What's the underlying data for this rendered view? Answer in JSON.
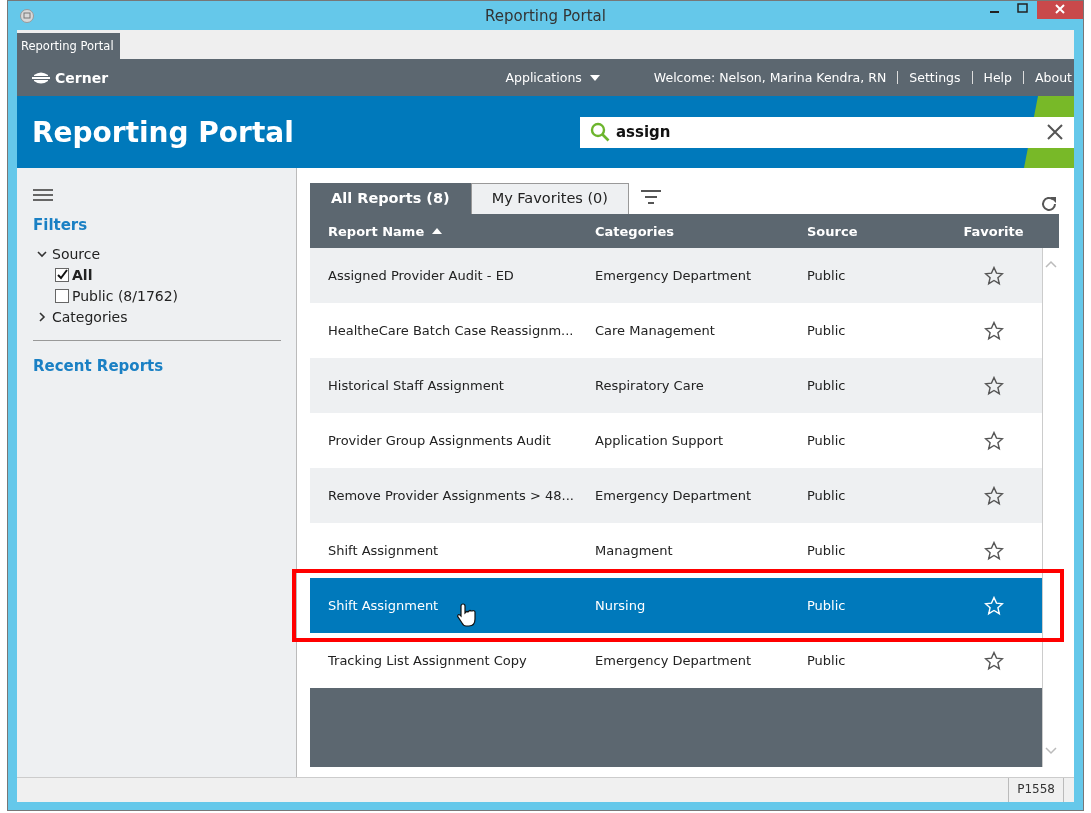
{
  "window": {
    "title": "Reporting Portal"
  },
  "app_tab": {
    "label": "Reporting Portal"
  },
  "nav": {
    "brand": "Cerner",
    "applications": "Applications",
    "welcome": "Welcome: Nelson, Marina Kendra, RN",
    "links": [
      "Settings",
      "Help",
      "About"
    ]
  },
  "banner": {
    "title": "Reporting Portal",
    "search": {
      "value": "assign"
    }
  },
  "sidebar": {
    "filters_title": "Filters",
    "groups": [
      {
        "label": "Source",
        "expanded": true,
        "children": [
          {
            "label": "All",
            "checked": true
          },
          {
            "label": "Public (8/1762)",
            "checked": false
          }
        ]
      },
      {
        "label": "Categories",
        "expanded": false
      }
    ],
    "recent_title": "Recent Reports"
  },
  "report_tabs": [
    {
      "label": "All Reports (8)",
      "selected": true
    },
    {
      "label": "My Favorites (0)",
      "selected": false
    }
  ],
  "table": {
    "columns": [
      "Report Name",
      "Categories",
      "Source",
      "Favorite"
    ],
    "rows": [
      {
        "name": "Assigned Provider Audit - ED",
        "category": "Emergency Department",
        "source": "Public",
        "selected": false,
        "highlighted": false
      },
      {
        "name": "HealtheCare Batch Case Reassignm...",
        "category": "Care Management",
        "source": "Public",
        "selected": false,
        "highlighted": false
      },
      {
        "name": "Historical Staff Assignment",
        "category": "Respiratory Care",
        "source": "Public",
        "selected": false,
        "highlighted": false
      },
      {
        "name": "Provider Group Assignments Audit",
        "category": "Application Support",
        "source": "Public",
        "selected": false,
        "highlighted": false
      },
      {
        "name": "Remove Provider Assignments > 48...",
        "category": "Emergency Department",
        "source": "Public",
        "selected": false,
        "highlighted": false
      },
      {
        "name": "Shift Assignment",
        "category": "Managment",
        "source": "Public",
        "selected": false,
        "highlighted": false
      },
      {
        "name": "Shift Assignment",
        "category": "Nursing",
        "source": "Public",
        "selected": true,
        "highlighted": true
      },
      {
        "name": "Tracking List Assignment Copy",
        "category": "Emergency Department",
        "source": "Public",
        "selected": false,
        "highlighted": false
      }
    ]
  },
  "status_bar": {
    "code": "P1558"
  }
}
